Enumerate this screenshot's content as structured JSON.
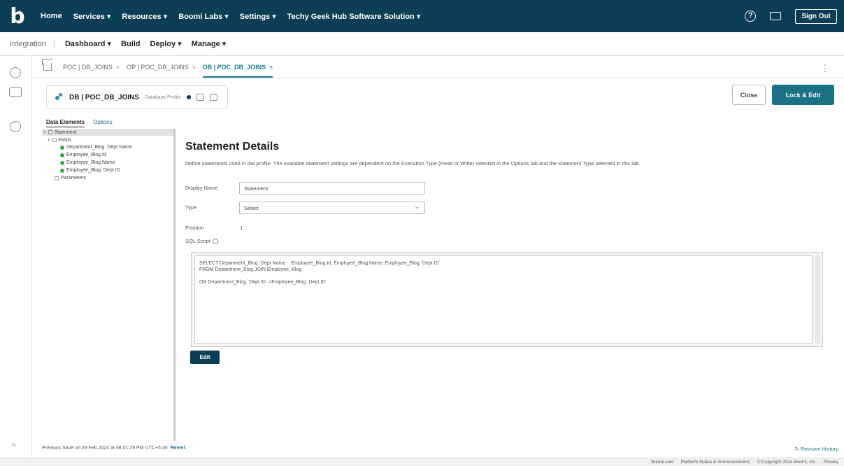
{
  "topnav": {
    "logo": "b",
    "items": [
      "Home",
      "Services ▾",
      "Resources ▾",
      "Boomi Labs ▾",
      "Settings ▾",
      "Techy Geek Hub Software Solution ▾"
    ],
    "sign_out": "Sign Out"
  },
  "subnav": {
    "root": "Integration",
    "items": [
      "Dashboard ▾",
      "Build",
      "Deploy ▾",
      "Manage ▾"
    ]
  },
  "tabs": {
    "items": [
      {
        "label": "POC | DB_JOINS"
      },
      {
        "label": "OP | POC_DB_JOINS"
      },
      {
        "label": "DB | POC_DB_JOINS"
      }
    ],
    "close": "×",
    "kebab": "⋮"
  },
  "component": {
    "title": "DB | POC_DB_JOINS",
    "tag": "Database Profile"
  },
  "actions": {
    "close": "Close",
    "lock_edit": "Lock & Edit"
  },
  "left_panel": {
    "tabs": [
      "Data Elements",
      "Options"
    ],
    "tree": [
      {
        "label": "Statement",
        "depth": 0
      },
      {
        "label": "Fields",
        "depth": 1
      },
      {
        "label": "Department_Blog. Dept Name",
        "depth": 2
      },
      {
        "label": "Employee_Blog.Id",
        "depth": 2
      },
      {
        "label": "Employee_Blog.Name",
        "depth": 2
      },
      {
        "label": "Employee_Blog. Dept ID",
        "depth": 2
      },
      {
        "label": "Parameters",
        "depth": 1
      }
    ]
  },
  "main": {
    "title": "Statement Details",
    "description": "Define statements used in the profile. The available statement settings are dependent on the Execution Type (Read or Write) selected in the Options tab and the statement Type selected in this tab.",
    "display_name_label": "Display Name",
    "display_name_value": "Statement",
    "type_label": "Type",
    "type_value": "Select",
    "position_label": "Position",
    "position_value": "1",
    "sql_label": "SQL Script",
    "sql_lines": [
      "SELECT Department_Blog.`Dept Name` , Employee_Blog.Id, Employee_Blog.Name, Employee_Blog.`Dept ID`",
      "FROM Department_Blog JOIN Employee_Blog",
      "",
      "ON Department_Blog.`Dept ID` =Employee_Blog.`Dept ID`"
    ],
    "edit_button": "Edit"
  },
  "footer": {
    "save_text": "Previous Save on 29 Feb 2024 at 08:01:29 PM UTC+5:30",
    "revert": "Revert",
    "revision_history": "Revision History",
    "links": [
      "Boomi.com",
      "Platform Status & Announcements",
      "© Copyright 2024 Boomi, Inc.",
      "Privacy"
    ]
  }
}
